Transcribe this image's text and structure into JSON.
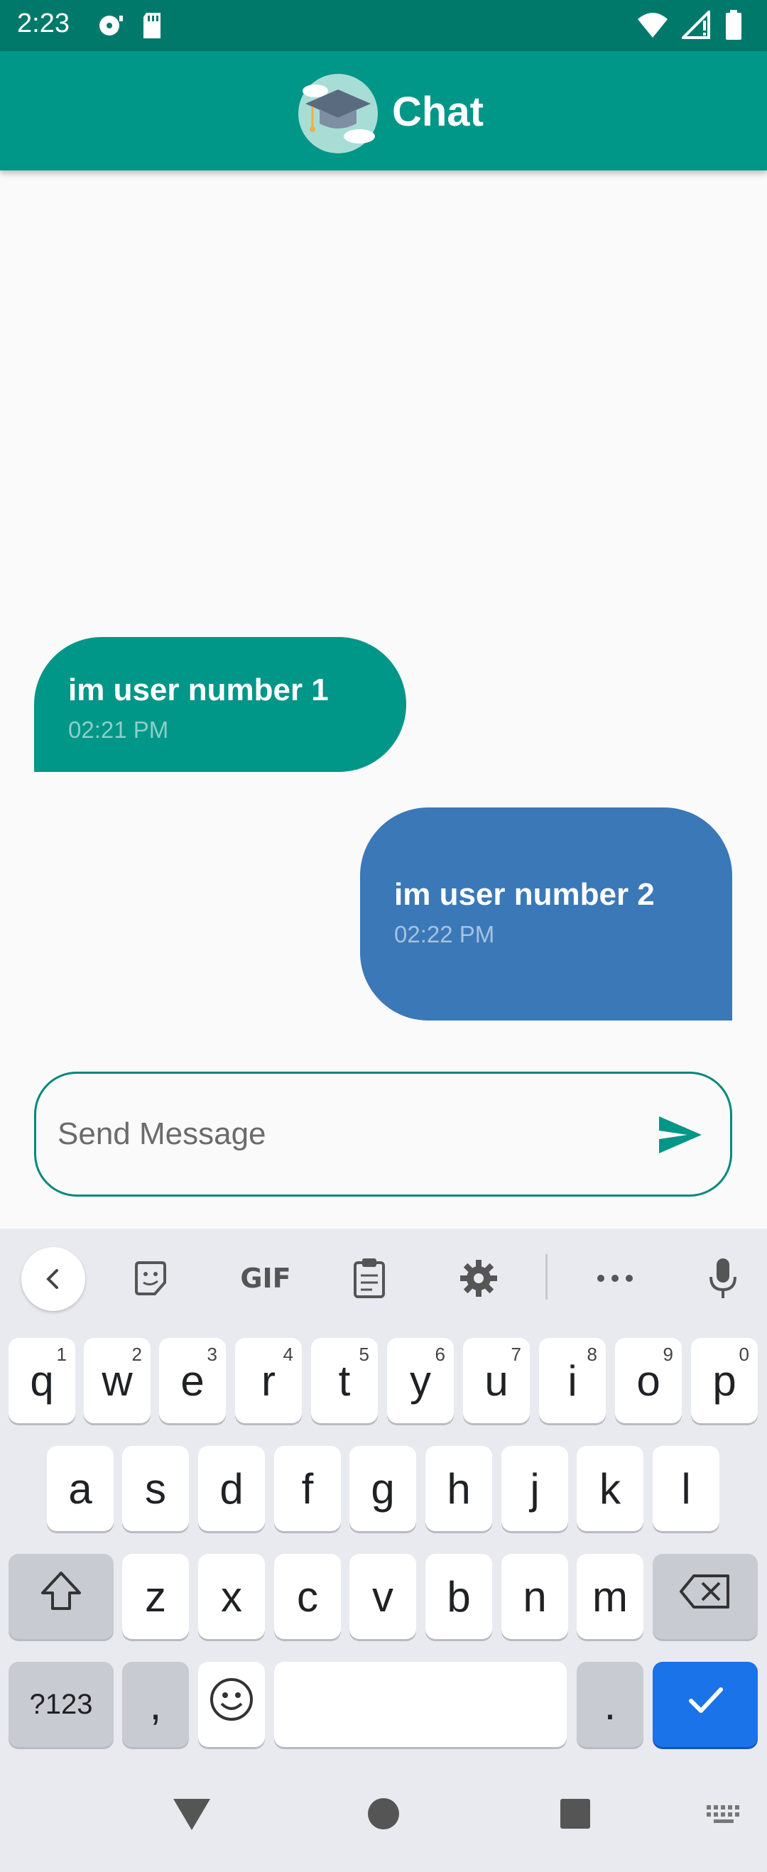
{
  "status_bar": {
    "time": "2:23",
    "icons": [
      "media-icon",
      "sd-card-icon",
      "wifi-icon",
      "signal-icon",
      "battery-icon"
    ]
  },
  "app_bar": {
    "title": "Chat",
    "logo": "graduation-cap-logo"
  },
  "messages": [
    {
      "text": "im user number 1",
      "time": "02:21 PM",
      "side": "left",
      "color": "#009688"
    },
    {
      "text": "im user number 2",
      "time": "02:22 PM",
      "side": "right",
      "color": "#3a78b8"
    }
  ],
  "composer": {
    "placeholder": "Send Message",
    "value": "",
    "send_icon": "send-icon"
  },
  "keyboard": {
    "toolbar": {
      "gif_label": "GIF",
      "icons": [
        "back-icon",
        "sticker-icon",
        "clipboard-icon",
        "settings-icon",
        "more-icon",
        "mic-icon"
      ]
    },
    "row1": [
      {
        "k": "q",
        "h": "1"
      },
      {
        "k": "w",
        "h": "2"
      },
      {
        "k": "e",
        "h": "3"
      },
      {
        "k": "r",
        "h": "4"
      },
      {
        "k": "t",
        "h": "5"
      },
      {
        "k": "y",
        "h": "6"
      },
      {
        "k": "u",
        "h": "7"
      },
      {
        "k": "i",
        "h": "8"
      },
      {
        "k": "o",
        "h": "9"
      },
      {
        "k": "p",
        "h": "0"
      }
    ],
    "row2": [
      "a",
      "s",
      "d",
      "f",
      "g",
      "h",
      "j",
      "k",
      "l"
    ],
    "row3": [
      "z",
      "x",
      "c",
      "v",
      "b",
      "n",
      "m"
    ],
    "row4": {
      "symbols": "?123",
      "comma": ",",
      "period": "."
    }
  },
  "colors": {
    "status_bar": "#00796b",
    "app_bar": "#009688",
    "accent": "#00897b",
    "enter_key": "#1a73e8"
  }
}
